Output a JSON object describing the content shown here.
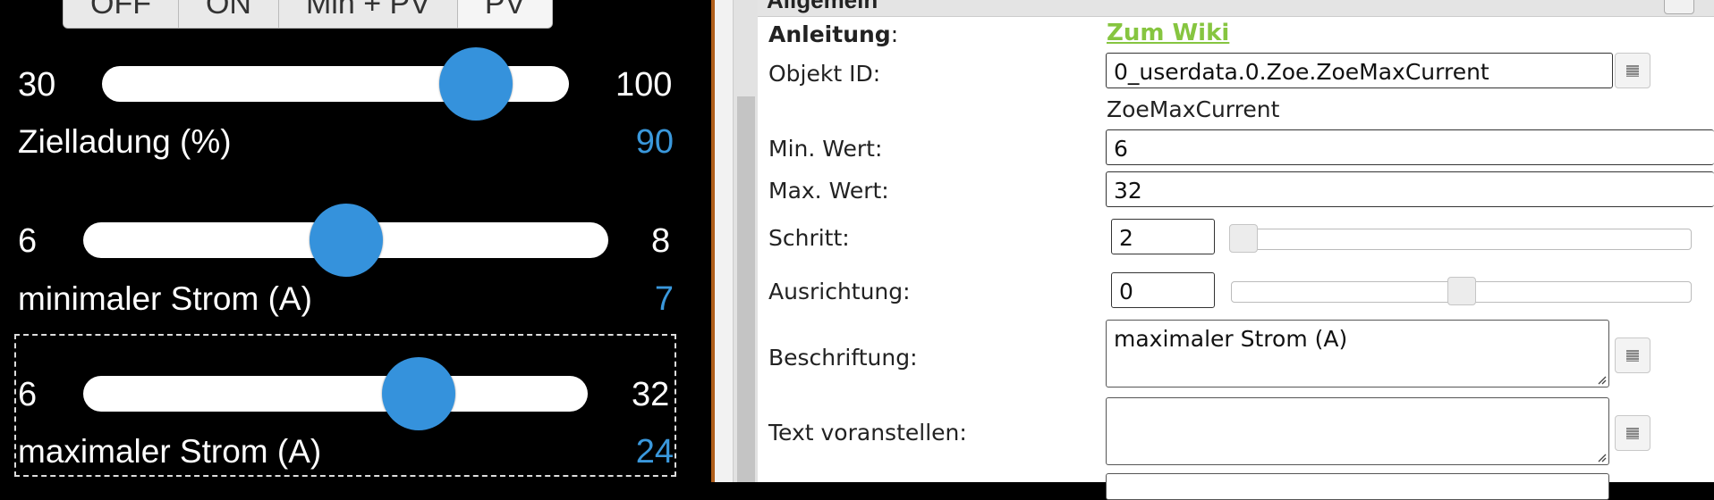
{
  "widget": {
    "mode_buttons": [
      "OFF",
      "ON",
      "Min + PV",
      "PV"
    ],
    "sliders": [
      {
        "min": "30",
        "max": "100",
        "label": "Zielladung (%)",
        "value": "90",
        "position": 0.857
      },
      {
        "min": "6",
        "max": "8",
        "label": "minimaler Strom (A)",
        "value": "7",
        "position": 0.5
      },
      {
        "min": "6",
        "max": "32",
        "label": "maximaler Strom (A)",
        "value": "24",
        "position": 0.692
      }
    ],
    "colors": {
      "value": "#3a98dc",
      "thumb": "#3592dc",
      "divider": "#b05e1a"
    }
  },
  "inspector": {
    "section_title": "Allgemein",
    "fields": {
      "anleitung": {
        "label": "Anleitung",
        "colon": ":",
        "link": "Zum Wiki"
      },
      "objekt_id": {
        "label": "Objekt ID:",
        "value": "0_userdata.0.Zoe.ZoeMaxCurrent",
        "subtext": "ZoeMaxCurrent"
      },
      "min": {
        "label": "Min. Wert:",
        "value": "6"
      },
      "max": {
        "label": "Max. Wert:",
        "value": "32"
      },
      "step": {
        "label": "Schritt:",
        "value": "2",
        "slider_position": 0.0
      },
      "orientation": {
        "label": "Ausrichtung:",
        "value": "0",
        "slider_position": 0.5
      },
      "caption": {
        "label": "Beschriftung:",
        "value": "maximaler Strom (A)"
      },
      "prepend": {
        "label": "Text voranstellen:",
        "value": ""
      }
    },
    "colors": {
      "link": "#86c540"
    },
    "icons": [
      "id-picker-icon",
      "resize-grip-icon"
    ]
  }
}
